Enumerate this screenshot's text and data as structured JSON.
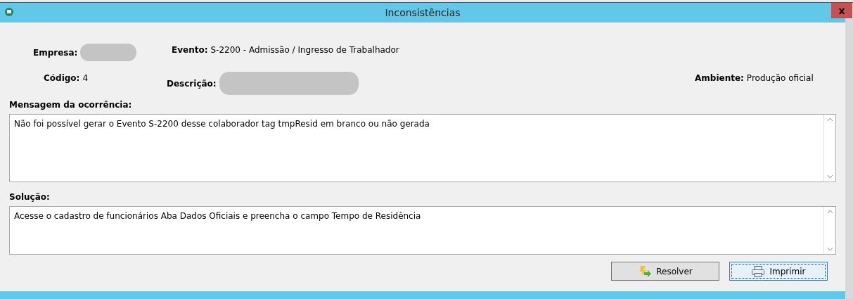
{
  "window": {
    "title": "Inconsistências",
    "close": "x"
  },
  "fields": [
    {
      "label": "Empresa:",
      "redacted": true
    },
    {
      "label": "Evento:",
      "value": "S-2200 - Admissão / Ingresso de Trabalhador"
    },
    {
      "label": "Código:",
      "value": "4"
    },
    {
      "label": "Descrição:",
      "redacted": true
    },
    {
      "label": "Ambiente:",
      "value": "Produção oficial"
    }
  ],
  "message": {
    "label": "Mensagem da ocorrência:",
    "text": "Não foi possível gerar o Evento S-2200 desse colaborador tag tmpResid em branco ou não gerada"
  },
  "solution": {
    "label": "Solução:",
    "text": "Acesse o cadastro de funcionários Aba Dados Oficiais e preencha o campo Tempo de Residência"
  },
  "buttons": [
    {
      "kind": "resolve",
      "label": "Resolver",
      "focused": false
    },
    {
      "kind": "print",
      "label": "Imprimir",
      "focused": true
    }
  ]
}
